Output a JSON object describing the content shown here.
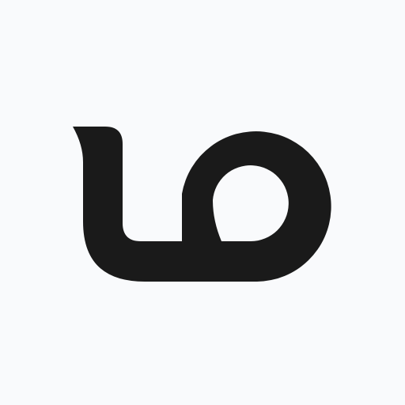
{
  "app": {
    "icon": "logo-mark-icon",
    "colors": {
      "background": "#f9fafc",
      "mark": "#1a1a1a"
    }
  }
}
